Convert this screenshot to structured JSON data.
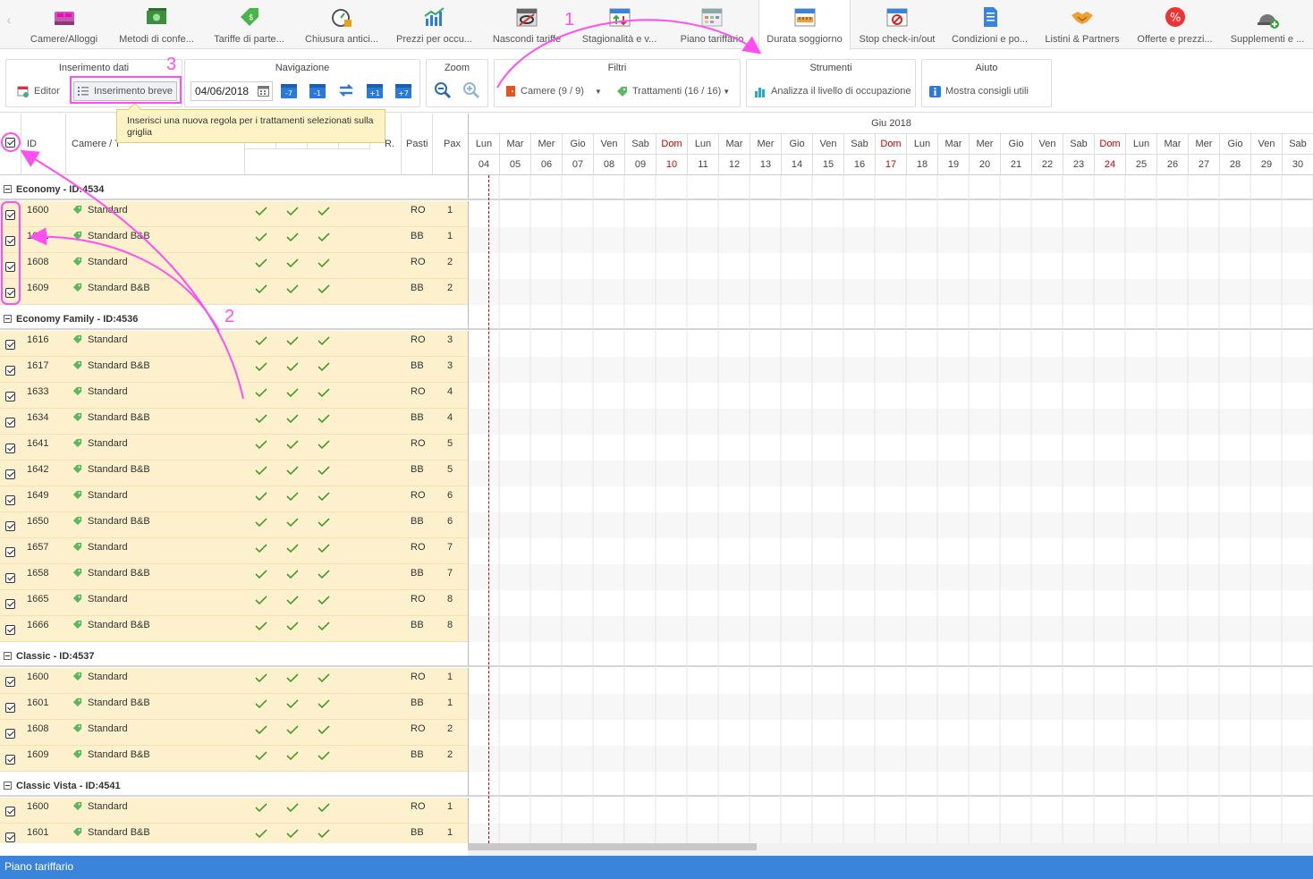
{
  "tabs": [
    {
      "label": "Camere/Alloggi",
      "icon": "bed-icon",
      "active": false
    },
    {
      "label": "Metodi di confe...",
      "icon": "money-icon",
      "active": false
    },
    {
      "label": "Tariffe di parte...",
      "icon": "price-tag-icon",
      "active": false
    },
    {
      "label": "Chiusura antici...",
      "icon": "stopwatch-icon",
      "active": false
    },
    {
      "label": "Prezzi per occu...",
      "icon": "bar-chart-icon",
      "active": false
    },
    {
      "label": "Nascondi tariffe",
      "icon": "hidden-calendar-icon",
      "active": false
    },
    {
      "label": "Stagionalità e v...",
      "icon": "season-calendar-icon",
      "active": false
    },
    {
      "label": "Piano tariffario",
      "icon": "grid-calendar-icon",
      "active": false
    },
    {
      "label": "Durata soggiorno",
      "icon": "ruler-calendar-icon",
      "active": true
    },
    {
      "label": "Stop check-in/out",
      "icon": "stop-calendar-icon",
      "active": false
    },
    {
      "label": "Condizioni e po...",
      "icon": "document-icon",
      "active": false
    },
    {
      "label": "Listini & Partners",
      "icon": "handshake-icon",
      "active": false
    },
    {
      "label": "Offerte e prezzi...",
      "icon": "percent-badge-icon",
      "active": false
    },
    {
      "label": "Supplementi e ...",
      "icon": "service-bell-icon",
      "active": false
    }
  ],
  "toolbar": {
    "inserimento": {
      "title": "Inserimento dati",
      "editor": "Editor",
      "breve": "Inserimento breve"
    },
    "navigazione": {
      "title": "Navigazione",
      "date": "04/06/2018",
      "buttons": [
        "-7",
        "-1",
        "",
        "+1",
        "+7"
      ]
    },
    "zoom": {
      "title": "Zoom"
    },
    "filtri": {
      "title": "Filtri",
      "camere": "Camere (9 / 9)",
      "trattamenti": "Trattamenti (16 / 16)"
    },
    "strumenti": {
      "title": "Strumenti",
      "analizza": "Analizza il livello di occupazione"
    },
    "aiuto": {
      "title": "Aiuto",
      "consigli": "Mostra consigli utili"
    }
  },
  "tooltip": "Inserisci una nuova regola per i trattamenti selezionati sulla griglia",
  "columns": {
    "id": "ID",
    "camere": "Camere / T",
    "r": "R.",
    "pasti": "Pasti",
    "pax": "Pax"
  },
  "calendar": {
    "month": "Giu 2018",
    "days": [
      {
        "name": "Lun",
        "day": "04",
        "sun": false
      },
      {
        "name": "Mar",
        "day": "05",
        "sun": false
      },
      {
        "name": "Mer",
        "day": "06",
        "sun": false
      },
      {
        "name": "Gio",
        "day": "07",
        "sun": false
      },
      {
        "name": "Ven",
        "day": "08",
        "sun": false
      },
      {
        "name": "Sab",
        "day": "09",
        "sun": false
      },
      {
        "name": "Dom",
        "day": "10",
        "sun": true
      },
      {
        "name": "Lun",
        "day": "11",
        "sun": false
      },
      {
        "name": "Mar",
        "day": "12",
        "sun": false
      },
      {
        "name": "Mer",
        "day": "13",
        "sun": false
      },
      {
        "name": "Gio",
        "day": "14",
        "sun": false
      },
      {
        "name": "Ven",
        "day": "15",
        "sun": false
      },
      {
        "name": "Sab",
        "day": "16",
        "sun": false
      },
      {
        "name": "Dom",
        "day": "17",
        "sun": true
      },
      {
        "name": "Lun",
        "day": "18",
        "sun": false
      },
      {
        "name": "Mar",
        "day": "19",
        "sun": false
      },
      {
        "name": "Mer",
        "day": "20",
        "sun": false
      },
      {
        "name": "Gio",
        "day": "21",
        "sun": false
      },
      {
        "name": "Ven",
        "day": "22",
        "sun": false
      },
      {
        "name": "Sab",
        "day": "23",
        "sun": false
      },
      {
        "name": "Dom",
        "day": "24",
        "sun": true
      },
      {
        "name": "Lun",
        "day": "25",
        "sun": false
      },
      {
        "name": "Mar",
        "day": "26",
        "sun": false
      },
      {
        "name": "Mer",
        "day": "27",
        "sun": false
      },
      {
        "name": "Gio",
        "day": "28",
        "sun": false
      },
      {
        "name": "Ven",
        "day": "29",
        "sun": false
      },
      {
        "name": "Sab",
        "day": "30",
        "sun": false
      }
    ]
  },
  "groups": [
    {
      "title": "Economy - ID:4534",
      "rows": [
        {
          "id": "1600",
          "name": "Standard",
          "pasti": "RO",
          "pax": "1"
        },
        {
          "id": "1601",
          "name": "Standard B&B",
          "pasti": "BB",
          "pax": "1"
        },
        {
          "id": "1608",
          "name": "Standard",
          "pasti": "RO",
          "pax": "2"
        },
        {
          "id": "1609",
          "name": "Standard B&B",
          "pasti": "BB",
          "pax": "2"
        }
      ]
    },
    {
      "title": "Economy Family - ID:4536",
      "rows": [
        {
          "id": "1616",
          "name": "Standard",
          "pasti": "RO",
          "pax": "3"
        },
        {
          "id": "1617",
          "name": "Standard B&B",
          "pasti": "BB",
          "pax": "3"
        },
        {
          "id": "1633",
          "name": "Standard",
          "pasti": "RO",
          "pax": "4"
        },
        {
          "id": "1634",
          "name": "Standard B&B",
          "pasti": "BB",
          "pax": "4"
        },
        {
          "id": "1641",
          "name": "Standard",
          "pasti": "RO",
          "pax": "5"
        },
        {
          "id": "1642",
          "name": "Standard B&B",
          "pasti": "BB",
          "pax": "5"
        },
        {
          "id": "1649",
          "name": "Standard",
          "pasti": "RO",
          "pax": "6"
        },
        {
          "id": "1650",
          "name": "Standard B&B",
          "pasti": "BB",
          "pax": "6"
        },
        {
          "id": "1657",
          "name": "Standard",
          "pasti": "RO",
          "pax": "7"
        },
        {
          "id": "1658",
          "name": "Standard B&B",
          "pasti": "BB",
          "pax": "7"
        },
        {
          "id": "1665",
          "name": "Standard",
          "pasti": "RO",
          "pax": "8"
        },
        {
          "id": "1666",
          "name": "Standard B&B",
          "pasti": "BB",
          "pax": "8"
        }
      ]
    },
    {
      "title": "Classic - ID:4537",
      "rows": [
        {
          "id": "1600",
          "name": "Standard",
          "pasti": "RO",
          "pax": "1"
        },
        {
          "id": "1601",
          "name": "Standard B&B",
          "pasti": "BB",
          "pax": "1"
        },
        {
          "id": "1608",
          "name": "Standard",
          "pasti": "RO",
          "pax": "2"
        },
        {
          "id": "1609",
          "name": "Standard B&B",
          "pasti": "BB",
          "pax": "2"
        }
      ]
    },
    {
      "title": "Classic Vista - ID:4541",
      "rows": [
        {
          "id": "1600",
          "name": "Standard",
          "pasti": "RO",
          "pax": "1"
        },
        {
          "id": "1601",
          "name": "Standard B&B",
          "pasti": "BB",
          "pax": "1"
        }
      ]
    }
  ],
  "annotations": [
    "1",
    "2",
    "3"
  ],
  "status": "Piano tariffario",
  "colors": {
    "annotation": "#ff4ff0",
    "accent": "#3b84db",
    "row_bg": "#fdf1cd",
    "sunday": "#cc0000",
    "check": "#4a9a2e"
  }
}
